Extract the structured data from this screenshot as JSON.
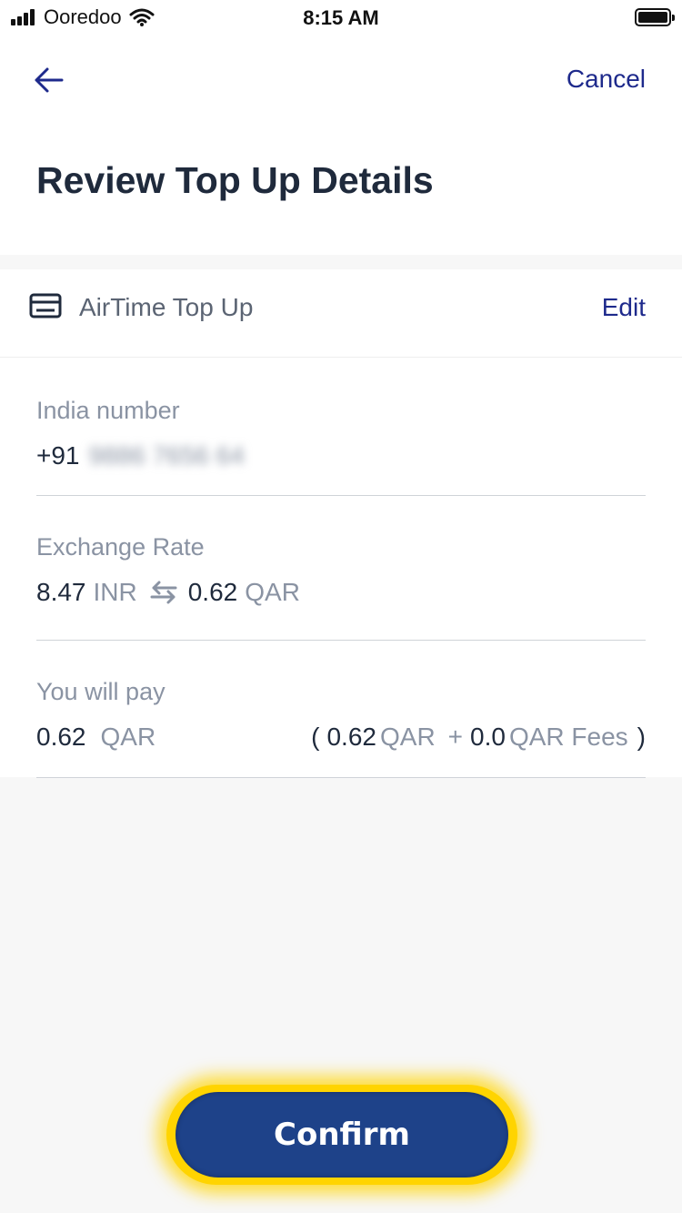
{
  "status_bar": {
    "carrier": "Ooredoo",
    "time": "8:15 AM",
    "icons": [
      "signal-icon",
      "wifi-icon",
      "battery-icon"
    ]
  },
  "header": {
    "back_icon": "back-arrow-icon",
    "cancel_label": "Cancel",
    "title": "Review Top Up Details"
  },
  "card": {
    "icon": "card-icon",
    "title": "AirTime Top Up",
    "edit_label": "Edit"
  },
  "details": {
    "india_number": {
      "label": "India number",
      "prefix": "+91",
      "number_masked": "9886 7656 64"
    },
    "exchange_rate": {
      "label": "Exchange Rate",
      "from_amount": "8.47",
      "from_currency": "INR",
      "to_amount": "0.62",
      "to_currency": "QAR",
      "swap_icon": "swap-arrows-icon"
    },
    "you_will_pay": {
      "label": "You will pay",
      "amount": "0.62",
      "currency": "QAR",
      "breakdown_open": "(",
      "breakdown_amount": "0.62",
      "breakdown_currency": "QAR",
      "plus": "+",
      "fee_amount": "0.0",
      "fee_label": "QAR Fees",
      "breakdown_close": ")"
    }
  },
  "actions": {
    "confirm_label": "Confirm"
  },
  "colors": {
    "accent": "#1e2a8c",
    "confirm_bg": "#1e4289",
    "highlight": "#ffd400",
    "muted_text": "#8a93a3"
  }
}
